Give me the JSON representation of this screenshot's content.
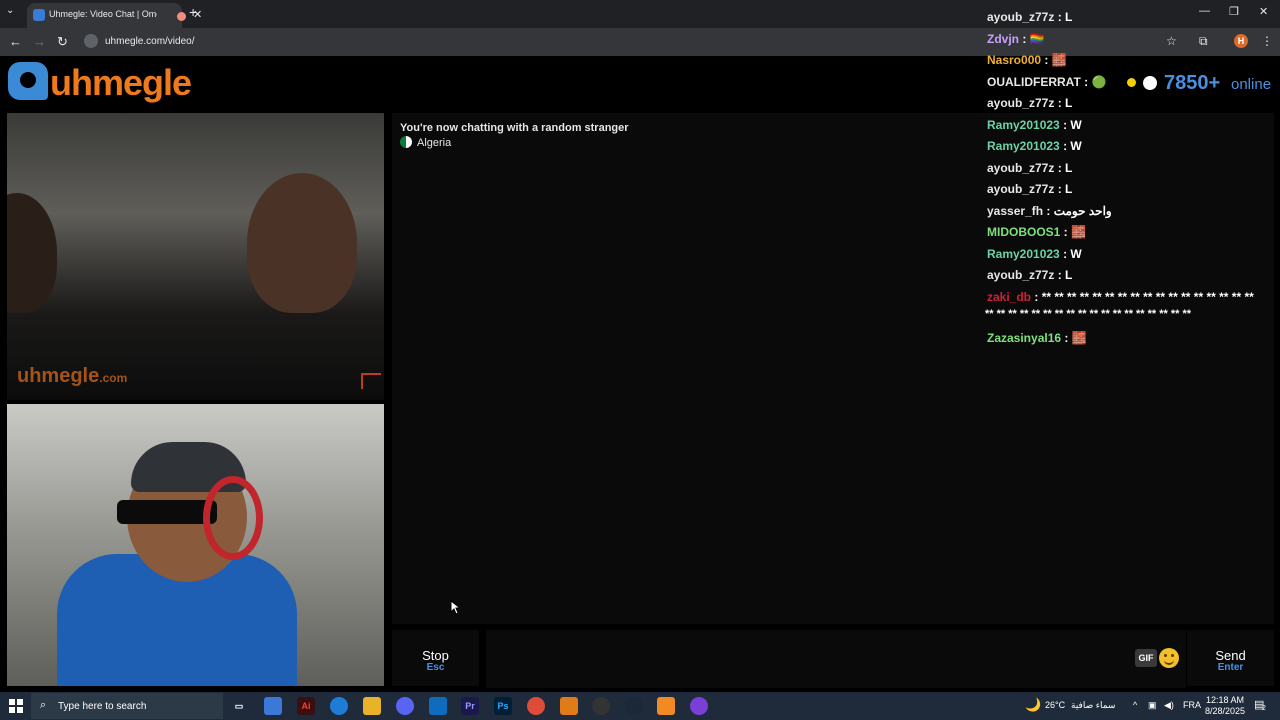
{
  "browser": {
    "tab_title": "Uhmegle: Video Chat | Ome...",
    "tab_close": "✕",
    "new_tab": "+",
    "url": "uhmegle.com/video/",
    "window_controls": {
      "minimize": "—",
      "maximize": "❐",
      "close": "✕"
    },
    "profile_initial": "H"
  },
  "site": {
    "logo_text": "uhmegle",
    "online_count": "7850+",
    "online_label": "online",
    "watermark": "uhmegle",
    "watermark_suffix": ".com"
  },
  "chat": {
    "status": "You're now chatting with a random stranger",
    "country": "Algeria",
    "stop_label": "Stop",
    "stop_key": "Esc",
    "send_label": "Send",
    "send_key": "Enter",
    "gif_label": "GIF"
  },
  "feed": [
    {
      "user": "ayoub_z77z",
      "color": "#e8e8e8",
      "msg": "L"
    },
    {
      "user": "Zdvjn",
      "color": "#c9a0ff",
      "msg": "🏳️‍🌈"
    },
    {
      "user": "Nasro000",
      "color": "#f0b030",
      "msg": "🧱"
    },
    {
      "user": "OUALIDFERRAT",
      "color": "#e8e8e8",
      "msg": "🟢"
    },
    {
      "user": "ayoub_z77z",
      "color": "#e8e8e8",
      "msg": "L"
    },
    {
      "user": "Ramy201023",
      "color": "#6ad3a8",
      "msg": "W"
    },
    {
      "user": "Ramy201023",
      "color": "#6ad3a8",
      "msg": "W"
    },
    {
      "user": "ayoub_z77z",
      "color": "#e8e8e8",
      "msg": "L"
    },
    {
      "user": "ayoub_z77z",
      "color": "#e8e8e8",
      "msg": "L"
    },
    {
      "user": "yasser_fh",
      "color": "#e8e8e8",
      "msg": "واحد حومت"
    },
    {
      "user": "MIDOBOOS1",
      "color": "#7ee07e",
      "msg": "🧱"
    },
    {
      "user": "Ramy201023",
      "color": "#6ad3a8",
      "msg": "W"
    },
    {
      "user": "ayoub_z77z",
      "color": "#e8e8e8",
      "msg": "L"
    },
    {
      "user": "zaki_db",
      "color": "#d0203a",
      "msg": "** ** ** ** ** ** ** ** ** ** ** ** ** ** ** ** **",
      "msg2": "** ** ** ** ** ** ** ** ** ** ** ** ** ** ** ** ** **"
    },
    {
      "user": "Zazasinyal16",
      "color": "#7ee07e",
      "msg": "🧱"
    }
  ],
  "taskbar": {
    "search_placeholder": "Type here to search",
    "weather_temp": "26°C",
    "weather_desc": "سماء صافية",
    "language": "FRA",
    "time": "12:18 AM",
    "date": "8/28/2025",
    "notifications": "2"
  }
}
